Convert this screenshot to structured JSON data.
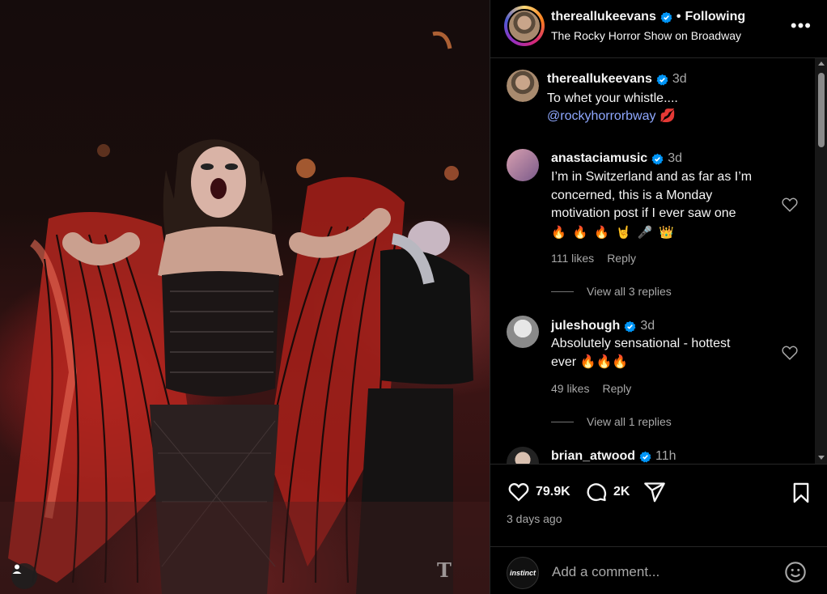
{
  "post": {
    "username": "thereallukeevans",
    "separator": "•",
    "follow_state": "Following",
    "subtitle": "The Rocky Horror Show on Broadway",
    "more_label": "•••",
    "caption": {
      "username": "thereallukeevans",
      "time": "3d",
      "text": "To whet your whistle....",
      "mention": "@rockyhorrorbway",
      "emoji": "💋"
    },
    "likes": "79.9K",
    "comments_count": "2K",
    "time_ago": "3 days ago"
  },
  "comments": [
    {
      "username": "anastaciamusic",
      "time": "3d",
      "lines": [
        "I’m in Switzerland and as far as I’m",
        "concerned, this is a Monday",
        "motivation post if I ever saw one"
      ],
      "emoji_line": "🔥🔥🔥🤘🎤👑",
      "likes": "111 likes",
      "reply": "Reply",
      "view_replies": "View all 3 replies"
    },
    {
      "username": "juleshough",
      "time": "3d",
      "lines": [
        "Absolutely sensational - hottest",
        "ever 🔥🔥🔥"
      ],
      "likes": "49 likes",
      "reply": "Reply",
      "view_replies": "View all 1 replies"
    },
    {
      "username": "brian_atwood",
      "time": "11h"
    }
  ],
  "add_comment": {
    "avatar_label": "instinct",
    "placeholder": "Add a comment..."
  },
  "media": {
    "watermark": "T"
  },
  "icons": {
    "verified": "verified-badge-icon",
    "heart": "heart-icon",
    "comment": "comment-icon",
    "share": "share-icon",
    "save": "bookmark-icon",
    "emoji": "emoji-icon",
    "user_tag": "user-tag-icon"
  },
  "colors": {
    "accent_link": "#8fa8ff",
    "verified": "#0095f6",
    "muted": "#a8a8a8"
  }
}
